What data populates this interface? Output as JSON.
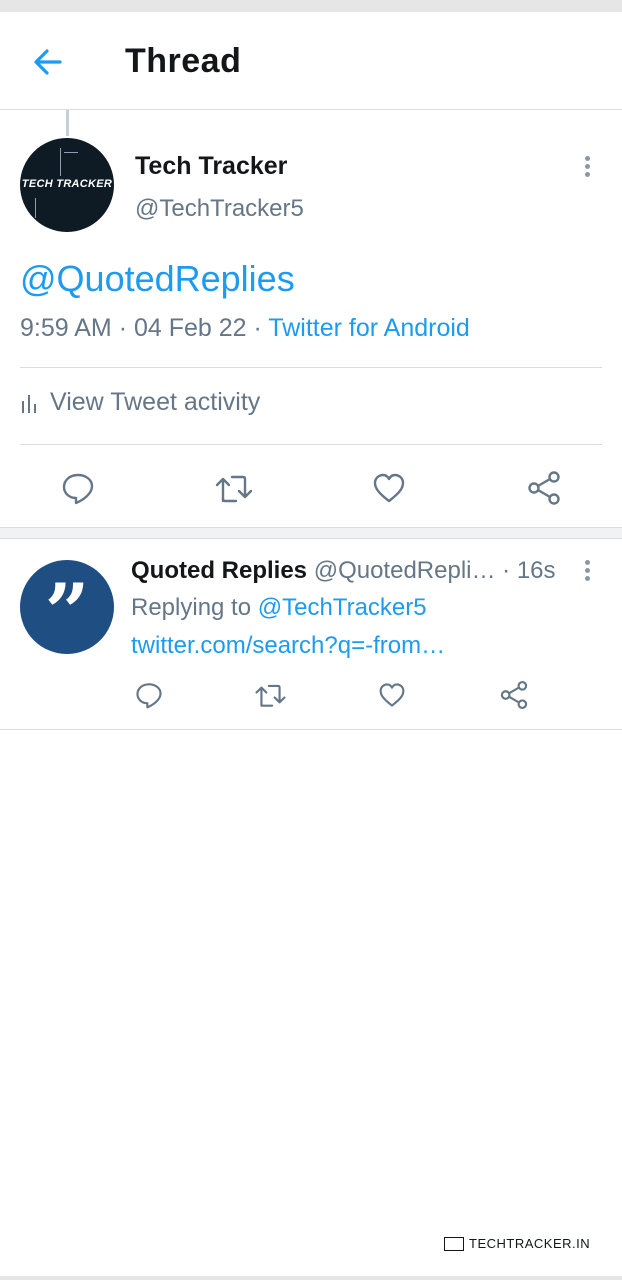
{
  "header": {
    "title": "Thread",
    "back_icon": "arrow-left-icon"
  },
  "main_tweet": {
    "avatar_label": "TECH TRACKER",
    "author_name": "Tech Tracker",
    "author_handle": "@TechTracker5",
    "text": "@QuotedReplies",
    "time": "9:59 AM",
    "date": "04 Feb 22",
    "source": "Twitter for Android",
    "activity_label": "View Tweet activity",
    "actions": [
      "reply-icon",
      "retweet-icon",
      "like-icon",
      "share-icon"
    ]
  },
  "reply_tweet": {
    "author_name": "Quoted Replies",
    "author_handle": "@QuotedRepli…",
    "time": "16s",
    "replying_prefix": "Replying to",
    "replying_to": "@TechTracker5",
    "link_text": "twitter.com/search?q=-from…",
    "actions": [
      "reply-icon",
      "retweet-icon",
      "like-icon",
      "share-icon"
    ]
  },
  "watermark": {
    "text": "TECHTRACKER.IN"
  },
  "colors": {
    "accent": "#1d9bf0",
    "muted": "#657786",
    "text": "#14171a"
  }
}
